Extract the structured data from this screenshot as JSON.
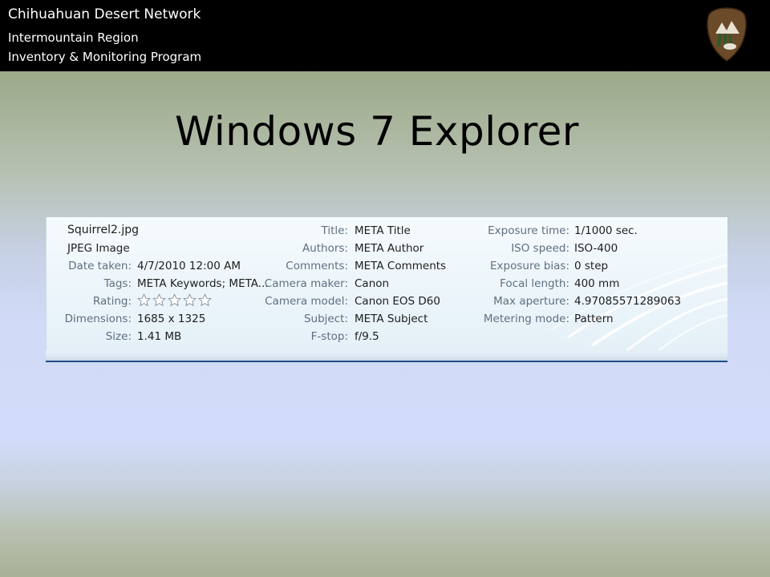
{
  "banner": {
    "line1": "Chihuahuan Desert Network",
    "line2": "Intermountain Region",
    "line3": "Inventory & Monitoring Program",
    "logo_icon": "nps-arrowhead-logo"
  },
  "slide_title": "Windows 7 Explorer",
  "details_pane": {
    "file_name": "Squirrel2.jpg",
    "file_type": "JPEG Image",
    "column1": [
      {
        "label": "Date taken:",
        "value": "4/7/2010 12:00 AM"
      },
      {
        "label": "Tags:",
        "value": "META Keywords; META..."
      },
      {
        "label": "Rating:",
        "value": ""
      },
      {
        "label": "Dimensions:",
        "value": "1685 x 1325"
      },
      {
        "label": "Size:",
        "value": "1.41 MB"
      }
    ],
    "rating": {
      "stars_filled": 0,
      "stars_total": 5
    },
    "column2": [
      {
        "label": "Title:",
        "value": "META Title"
      },
      {
        "label": "Authors:",
        "value": "META Author"
      },
      {
        "label": "Comments:",
        "value": "META Comments"
      },
      {
        "label": "Camera maker:",
        "value": "Canon"
      },
      {
        "label": "Camera model:",
        "value": "Canon EOS D60"
      },
      {
        "label": "Subject:",
        "value": "META Subject"
      },
      {
        "label": "F-stop:",
        "value": "f/9.5"
      }
    ],
    "column3": [
      {
        "label": "Exposure time:",
        "value": "1/1000 sec."
      },
      {
        "label": "ISO speed:",
        "value": "ISO-400"
      },
      {
        "label": "Exposure bias:",
        "value": "0 step"
      },
      {
        "label": "Focal length:",
        "value": "400 mm"
      },
      {
        "label": "Max aperture:",
        "value": "4.97085571289063"
      },
      {
        "label": "Metering mode:",
        "value": "Pattern"
      }
    ]
  },
  "colors": {
    "banner_bg": "#000000",
    "label_text": "#5f6f80",
    "value_text": "#1e1e1e",
    "pane_bottom_border": "#1d4d8a"
  }
}
